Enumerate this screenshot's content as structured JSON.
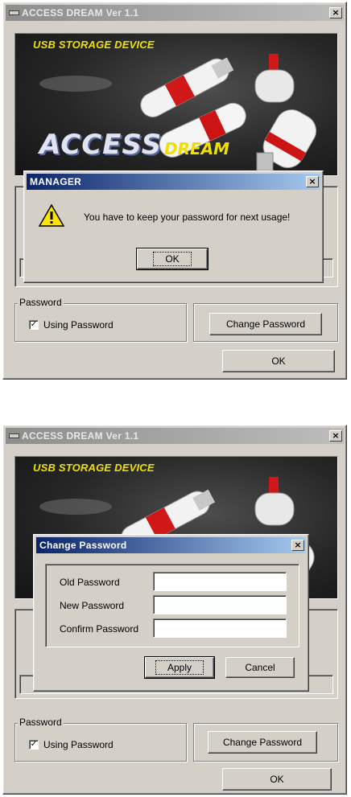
{
  "panel_top": {
    "window_title": "ACCESS DREAM Ver 1.1",
    "close_glyph": "×",
    "banner": {
      "subtitle": "USB STORAGE DEVICE",
      "logo_main": "ACCESS",
      "logo_sub": "DREAM"
    },
    "password_group": {
      "label": "Password",
      "checkbox_label": "Using Password",
      "checked": true,
      "check_glyph": "✓"
    },
    "change_password_button": "Change Password",
    "ok_button": "OK",
    "dialog": {
      "title": "MANAGER",
      "close_glyph": "×",
      "icon": "warning-icon",
      "message": "You have to keep your password for next usage!",
      "ok_button": "OK"
    }
  },
  "panel_bottom": {
    "window_title": "ACCESS DREAM Ver 1.1",
    "close_glyph": "×",
    "banner": {
      "subtitle": "USB STORAGE DEVICE"
    },
    "password_group": {
      "label": "Password",
      "checkbox_label": "Using Password",
      "checked": true,
      "check_glyph": "✓"
    },
    "change_password_button": "Change Password",
    "ok_button": "OK",
    "dialog": {
      "title": "Change Password",
      "close_glyph": "×",
      "fields": [
        {
          "label": "Old Password",
          "value": ""
        },
        {
          "label": "New Password",
          "value": ""
        },
        {
          "label": "Confirm Password",
          "value": ""
        }
      ],
      "apply_button": "Apply",
      "cancel_button": "Cancel"
    }
  },
  "colors": {
    "face": "#d4d0c8",
    "active_title": "#0a246a",
    "inactive_title": "#8d8d8d",
    "banner_yellow": "#f0e000"
  }
}
